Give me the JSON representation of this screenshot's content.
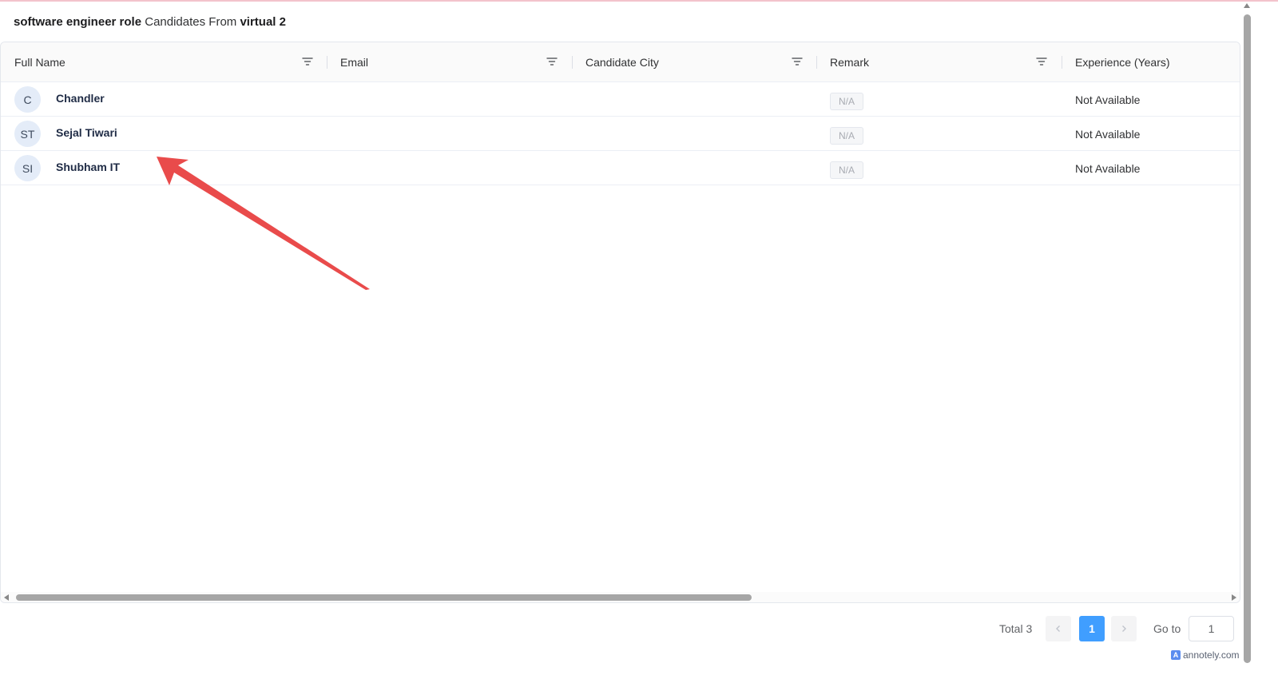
{
  "page": {
    "title_bold_1": "software engineer role",
    "title_mid": " Candidates From ",
    "title_bold_2": "virtual 2"
  },
  "table": {
    "columns": [
      {
        "label": "Full Name"
      },
      {
        "label": "Email"
      },
      {
        "label": "Candidate City"
      },
      {
        "label": "Remark"
      },
      {
        "label": "Experience (Years)"
      }
    ],
    "rows": [
      {
        "initials": "C",
        "name": "Chandler",
        "remark": "N/A",
        "experience": "Not Available"
      },
      {
        "initials": "ST",
        "name": "Sejal Tiwari",
        "remark": "N/A",
        "experience": "Not Available"
      },
      {
        "initials": "SI",
        "name": "Shubham IT",
        "remark": "N/A",
        "experience": "Not Available"
      }
    ]
  },
  "pagination": {
    "total_label": "Total 3",
    "current_page": "1",
    "goto_label": "Go to",
    "goto_value": "1",
    "prev_icon": "chevron-left-icon",
    "next_icon": "chevron-right-icon"
  },
  "watermark": {
    "logo_letter": "A",
    "text": "annotely.com"
  },
  "colors": {
    "accent": "#409eff",
    "annotation_arrow": "#e94b4b",
    "avatar_bg": "#e4ecf8"
  }
}
